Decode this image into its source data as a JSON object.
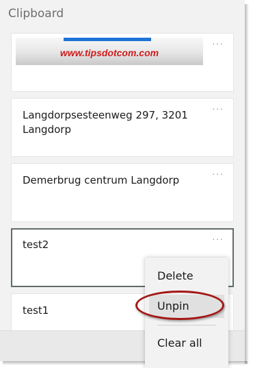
{
  "panel": {
    "title": "Clipboard"
  },
  "items": [
    {
      "type": "image",
      "banner_text": "www.tipsdotcom.com",
      "more_label": "···"
    },
    {
      "type": "text",
      "text": "Langdorpsesteenweg 297, 3201 Langdorp",
      "more_label": "···"
    },
    {
      "type": "text",
      "text": "Demerbrug centrum Langdorp",
      "more_label": "···"
    },
    {
      "type": "text",
      "text": "test2",
      "more_label": "···",
      "selected": true
    },
    {
      "type": "text",
      "text": "test1",
      "more_label": "···"
    }
  ],
  "context_menu": {
    "items": [
      {
        "label": "Delete"
      },
      {
        "label": "Unpin",
        "highlighted": true
      },
      {
        "label": "Clear all"
      }
    ]
  },
  "colors": {
    "accent_blue": "#1e73d6",
    "banner_red": "#d01b1b",
    "highlight_circle": "#a41616"
  }
}
